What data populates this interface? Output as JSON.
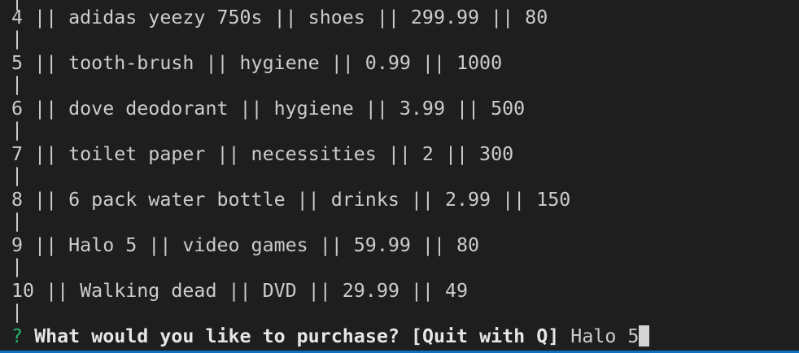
{
  "terminal": {
    "top_separator": "|",
    "rows": [
      {
        "text": "4 || adidas yeezy 750s || shoes || 299.99 || 80",
        "separator": "|"
      },
      {
        "text": "5 || tooth-brush || hygiene || 0.99 || 1000",
        "separator": "|"
      },
      {
        "text": "6 || dove deodorant || hygiene || 3.99 || 500",
        "separator": "|"
      },
      {
        "text": "7 || toilet paper || necessities || 2 || 300",
        "separator": "|"
      },
      {
        "text": "8 || 6 pack water bottle || drinks || 2.99 || 150",
        "separator": "|"
      },
      {
        "text": "9 || Halo 5 || video games || 59.99 || 80",
        "separator": "|"
      },
      {
        "text": "10 || Walking dead || DVD || 29.99 || 49",
        "separator": "|"
      }
    ],
    "prompt": {
      "mark": "?",
      "question": "What would you like to purchase? [Quit with Q]",
      "answer": "Halo 5"
    }
  },
  "colors": {
    "background": "#1e1e1e",
    "text": "#cccccc",
    "prompt_mark": "#23b26b",
    "cursor": "#d4d4d4",
    "bottom_bar": "#0e70c0"
  }
}
